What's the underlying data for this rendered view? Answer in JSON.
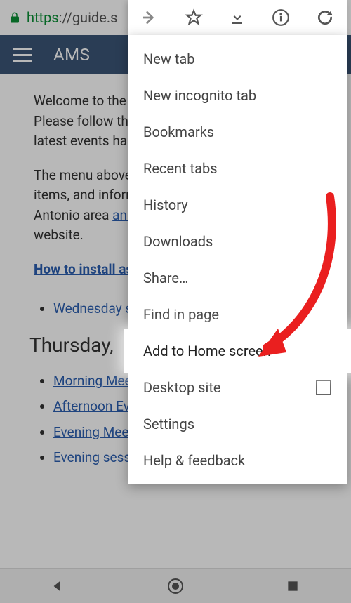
{
  "address": {
    "protocol": "https",
    "rest": "://guide.s"
  },
  "header": {
    "title": "AMS"
  },
  "content": {
    "p1": "Welcome to the Annual Meeting guide page! Please follow the links for information on the latest events happening this week.",
    "p2_a": "The menu above has links to the maps, a list of items, and information about the area. The San Antonio area ",
    "p2_link": "announcements",
    "p2_b": " are on the website.",
    "install_link": "How to install as app",
    "wed_label": "Wednesday sessions",
    "thursday_heading": "Thursday,",
    "li1": "Morning Meetings",
    "li2": "Afternoon Events",
    "li3": "Evening Meetings and Events",
    "li4": "Evening sessions"
  },
  "menu": {
    "items": [
      "New tab",
      "New incognito tab",
      "Bookmarks",
      "Recent tabs",
      "History",
      "Downloads",
      "Share…",
      "Find in page",
      "Add to Home screen",
      "Desktop site",
      "Settings",
      "Help & feedback"
    ]
  },
  "toolbar": {
    "forward": "forward",
    "star": "star",
    "download": "download",
    "info": "info",
    "refresh": "refresh"
  }
}
